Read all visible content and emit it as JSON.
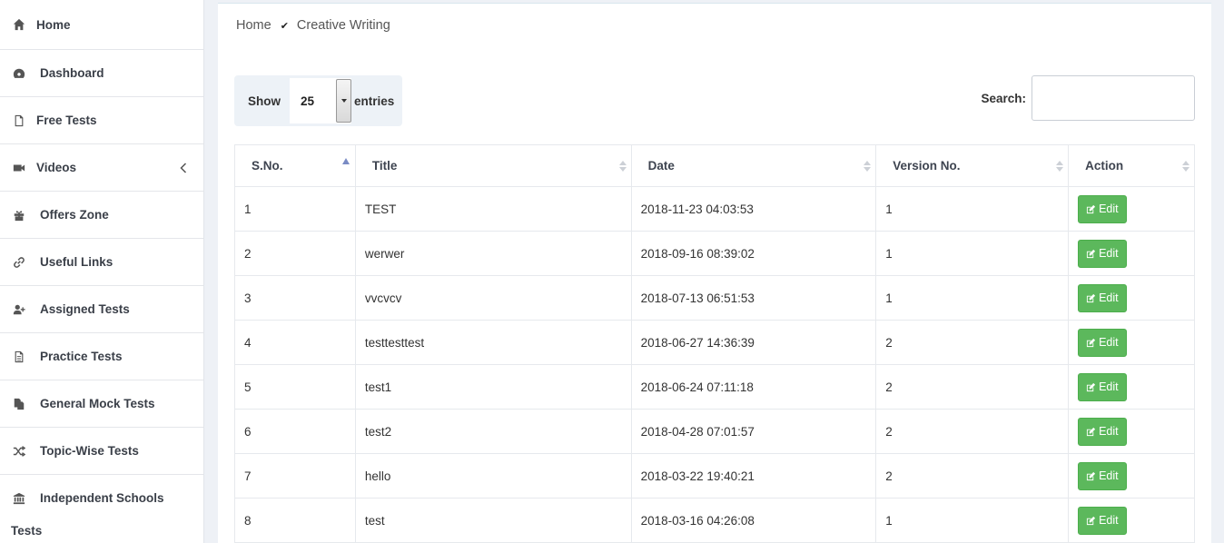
{
  "sidebar": {
    "items": [
      {
        "label": "Home",
        "icon": "home-icon"
      },
      {
        "label": "Dashboard",
        "icon": "dashboard-icon"
      },
      {
        "label": "Free Tests",
        "icon": "file-icon"
      },
      {
        "label": "Videos",
        "icon": "video-camera-icon"
      },
      {
        "label": "Offers Zone",
        "icon": "gift-icon"
      },
      {
        "label": "Useful Links",
        "icon": "link-icon"
      },
      {
        "label": "Assigned Tests",
        "icon": "user-plus-icon"
      },
      {
        "label": "Practice Tests",
        "icon": "file-text-icon"
      },
      {
        "label": "General Mock Tests",
        "icon": "files-icon"
      },
      {
        "label": "Topic-Wise Tests",
        "icon": "random-icon"
      },
      {
        "label": "Independent Schools",
        "label2": "Tests",
        "icon": "institution-icon"
      }
    ]
  },
  "breadcrumb": {
    "home": "Home",
    "current": "Creative Writing"
  },
  "table_controls": {
    "show_label": "Show",
    "entries_value": "25",
    "entries_label": "entries",
    "search_label": "Search:",
    "search_value": ""
  },
  "table": {
    "headers": [
      "S.No.",
      "Title",
      "Date",
      "Version No.",
      "Action"
    ],
    "edit_label": "Edit",
    "rows": [
      {
        "sno": "1",
        "title": "TEST",
        "date": "2018-11-23 04:03:53",
        "version": "1"
      },
      {
        "sno": "2",
        "title": "werwer",
        "date": "2018-09-16 08:39:02",
        "version": "1"
      },
      {
        "sno": "3",
        "title": "vvcvcv",
        "date": "2018-07-13 06:51:53",
        "version": "1"
      },
      {
        "sno": "4",
        "title": "testtesttest",
        "date": "2018-06-27 14:36:39",
        "version": "2"
      },
      {
        "sno": "5",
        "title": "test1",
        "date": "2018-06-24 07:11:18",
        "version": "2"
      },
      {
        "sno": "6",
        "title": "test2",
        "date": "2018-04-28 07:01:57",
        "version": "2"
      },
      {
        "sno": "7",
        "title": "hello",
        "date": "2018-03-22 19:40:21",
        "version": "2"
      },
      {
        "sno": "8",
        "title": "test",
        "date": "2018-03-16 04:26:08",
        "version": "1"
      }
    ]
  },
  "colors": {
    "edit_button": "#5cb85c",
    "sort_active": "#7a8bc4"
  }
}
